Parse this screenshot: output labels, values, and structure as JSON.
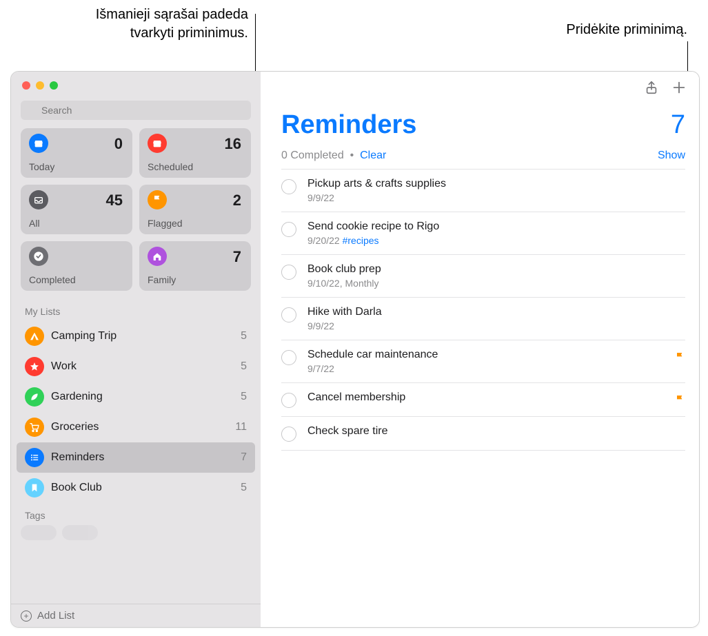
{
  "callouts": {
    "left": "Išmanieji sąrašai padeda tvarkyti priminimus.",
    "right": "Pridėkite priminimą."
  },
  "search": {
    "placeholder": "Search"
  },
  "smart": [
    {
      "label": "Today",
      "count": "0",
      "bg": "#0a7aff",
      "icon": "calendar"
    },
    {
      "label": "Scheduled",
      "count": "16",
      "bg": "#ff3b30",
      "icon": "calendar"
    },
    {
      "label": "All",
      "count": "45",
      "bg": "#5b5b60",
      "icon": "tray"
    },
    {
      "label": "Flagged",
      "count": "2",
      "bg": "#ff9500",
      "icon": "flag"
    },
    {
      "label": "Completed",
      "count": "",
      "bg": "#6e6e73",
      "icon": "check"
    },
    {
      "label": "Family",
      "count": "7",
      "bg": "#af52de",
      "icon": "house"
    }
  ],
  "sections": {
    "my_lists": "My Lists",
    "tags": "Tags"
  },
  "lists": [
    {
      "label": "Camping Trip",
      "count": "5",
      "bg": "#ff9500",
      "icon": "tent",
      "selected": false
    },
    {
      "label": "Work",
      "count": "5",
      "bg": "#ff3b30",
      "icon": "star",
      "selected": false
    },
    {
      "label": "Gardening",
      "count": "5",
      "bg": "#30d158",
      "icon": "leaf",
      "selected": false
    },
    {
      "label": "Groceries",
      "count": "11",
      "bg": "#ff9500",
      "icon": "cart",
      "selected": false
    },
    {
      "label": "Reminders",
      "count": "7",
      "bg": "#0a7aff",
      "icon": "list",
      "selected": true
    },
    {
      "label": "Book Club",
      "count": "5",
      "bg": "#64d2ff",
      "icon": "bookmark",
      "selected": false
    }
  ],
  "footer": {
    "add_list": "Add List"
  },
  "main": {
    "title": "Reminders",
    "count": "7",
    "completed_label": "0 Completed",
    "dot": "•",
    "clear": "Clear",
    "show": "Show"
  },
  "reminders": [
    {
      "title": "Pickup arts & crafts supplies",
      "meta": "9/9/22",
      "tag": "",
      "flagged": false
    },
    {
      "title": "Send cookie recipe to Rigo",
      "meta": "9/20/22 ",
      "tag": "#recipes",
      "flagged": false
    },
    {
      "title": "Book club prep",
      "meta": "9/10/22, Monthly",
      "tag": "",
      "flagged": false
    },
    {
      "title": "Hike with Darla",
      "meta": "9/9/22",
      "tag": "",
      "flagged": false
    },
    {
      "title": "Schedule car maintenance",
      "meta": "9/7/22",
      "tag": "",
      "flagged": true
    },
    {
      "title": "Cancel membership",
      "meta": "",
      "tag": "",
      "flagged": true
    },
    {
      "title": "Check spare tire",
      "meta": "",
      "tag": "",
      "flagged": false
    }
  ]
}
